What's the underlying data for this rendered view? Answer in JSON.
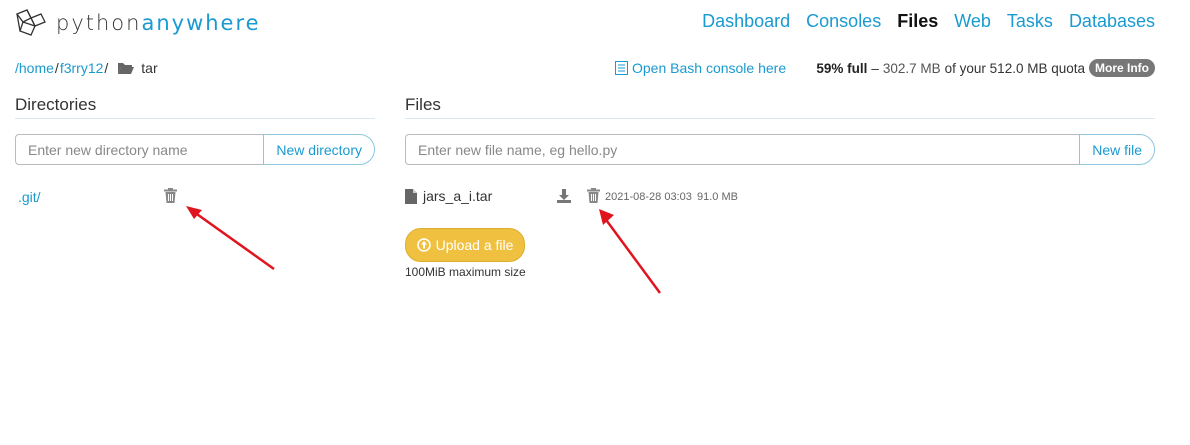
{
  "brand": {
    "part1": "python",
    "part2": "anywhere"
  },
  "nav": [
    "Dashboard",
    "Consoles",
    "Files",
    "Web",
    "Tasks",
    "Databases"
  ],
  "nav_active": "Files",
  "breadcrumb": {
    "root": "/home",
    "sep1": "/",
    "user": "f3rry12",
    "sep2": "/",
    "current": "tar"
  },
  "bash_link": "Open Bash console here",
  "quota": {
    "percent": "59% full",
    "dash": "–",
    "detail": "302.7 MB",
    "of": "of your 512.0 MB quota",
    "more": "More Info"
  },
  "directories": {
    "title": "Directories",
    "placeholder": "Enter new directory name",
    "button": "New directory",
    "items": [
      ".git/"
    ]
  },
  "files": {
    "title": "Files",
    "placeholder": "Enter new file name, eg hello.py",
    "button": "New file",
    "items": [
      {
        "name": "jars_a_i.tar",
        "date": "2021-08-28 03:03",
        "size": "91.0 MB"
      }
    ],
    "upload": "Upload a file",
    "upload_note": "100MiB maximum size"
  },
  "colors": {
    "accent": "#1a9ad0",
    "upload": "#f0c040",
    "arrow": "#e0141e"
  }
}
